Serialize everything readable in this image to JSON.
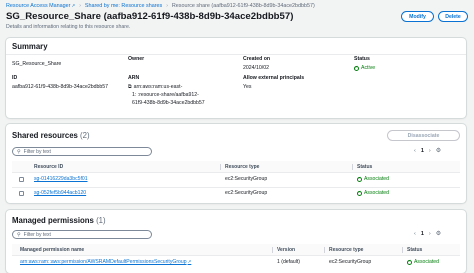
{
  "breadcrumbs": [
    {
      "label": "Resource Access Manager"
    },
    {
      "label": "Shared by me: Resource shares"
    },
    {
      "label": "Resource share (aafba912-61f9-438b-8d9b-34ace2bdbb57)"
    }
  ],
  "header": {
    "title": "SG_Resource_Share (aafba912-61f9-438b-8d9b-34ace2bdbb57)",
    "subtitle": "Details and information relating to this resource share.",
    "modify_label": "Modify",
    "delete_label": "Delete"
  },
  "summary": {
    "title": "Summary",
    "name_value": "SG_Resource_Share",
    "id_label": "ID",
    "id_value": "aafba912-61f9-438b-8d9b-34ace2bdbb57",
    "owner_label": "Owner",
    "arn_label": "ARN",
    "arn_line1": "arn:aws:ram:us-east-",
    "arn_line2": "1:                              :resource-share/aafba912-",
    "arn_line3": "61f9-438b-8d9b-34ace2bdbb57",
    "created_label": "Created on",
    "created_value": "2024/10/02",
    "external_label": "Allow external principals",
    "external_value": "Yes",
    "status_label": "Status",
    "status_value": "Active"
  },
  "shared_resources": {
    "title": "Shared resources",
    "count": "(2)",
    "disassociate_label": "Disassociate",
    "filter_placeholder": "Filter by text",
    "page": "1",
    "columns": [
      "Resource ID",
      "Resource type",
      "Status"
    ],
    "rows": [
      {
        "id": "sg-01416229da3bc5f01",
        "type": "ec2:SecurityGroup",
        "status": "Associated"
      },
      {
        "id": "sg-052fef5b944acb120",
        "type": "ec2:SecurityGroup",
        "status": "Associated"
      }
    ]
  },
  "managed_permissions": {
    "title": "Managed permissions",
    "count": "(1)",
    "filter_placeholder": "Filter by text",
    "page": "1",
    "columns": [
      "Managed permission name",
      "Version",
      "Resource type",
      "Status"
    ],
    "rows": [
      {
        "name": "arn:aws:ram::aws:permission/AWSRAMDefaultPermissionsSecurityGroup",
        "version": "1 (default)",
        "type": "ec2:SecurityGroup",
        "status": "Associated"
      }
    ]
  },
  "colors": {
    "link": "#0972d3",
    "success": "#037f0c",
    "text": "#16191f"
  },
  "icons": [
    "external-link-icon",
    "search-icon",
    "chevron-left-icon",
    "chevron-right-icon",
    "gear-icon",
    "status-success-icon",
    "copy-icon"
  ]
}
